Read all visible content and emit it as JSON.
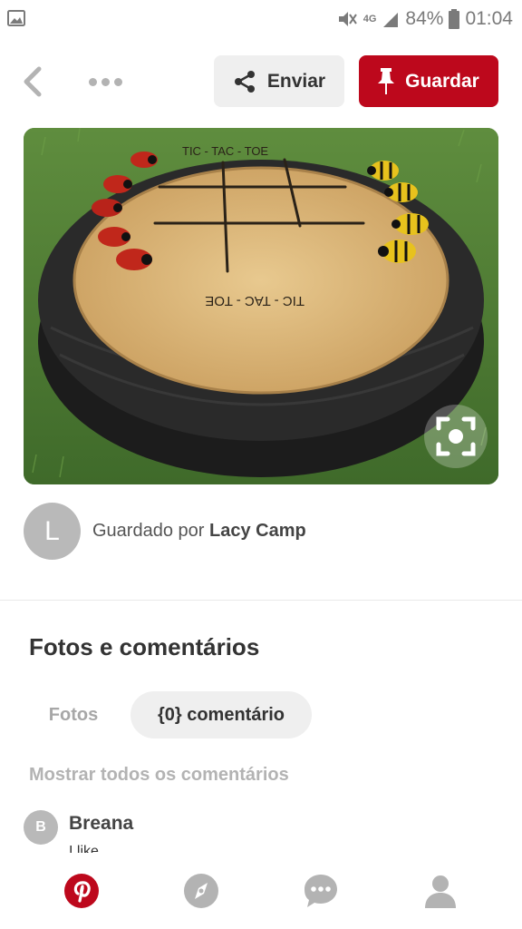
{
  "status_bar": {
    "network": "4G",
    "battery": "84%",
    "time": "01:04"
  },
  "top_bar": {
    "send_label": "Enviar",
    "save_label": "Guardar"
  },
  "pin_image": {
    "board_texts": [
      "TIC - TAC - TOE",
      "TIC - TAC - TOE",
      "TIC",
      "TOE",
      "TAC",
      "TOE"
    ]
  },
  "saved_by": {
    "avatar_letter": "L",
    "prefix": "Guardado por",
    "user": "Lacy Camp"
  },
  "comments_section": {
    "title": "Fotos e comentários",
    "tabs": [
      {
        "label": "Fotos",
        "active": false
      },
      {
        "label": "{0} comentário",
        "active": true
      }
    ],
    "show_all": "Mostrar todos os comentários",
    "comments": [
      {
        "avatar_letter": "B",
        "name": "Breana",
        "text": "I like"
      }
    ]
  },
  "bottom_nav": {
    "items": [
      "pinterest-home-icon",
      "compass-icon",
      "chat-icon",
      "profile-icon"
    ]
  },
  "colors": {
    "accent": "#bd081c",
    "icon_grey": "#b3b3b3",
    "button_bg": "#efefef"
  }
}
